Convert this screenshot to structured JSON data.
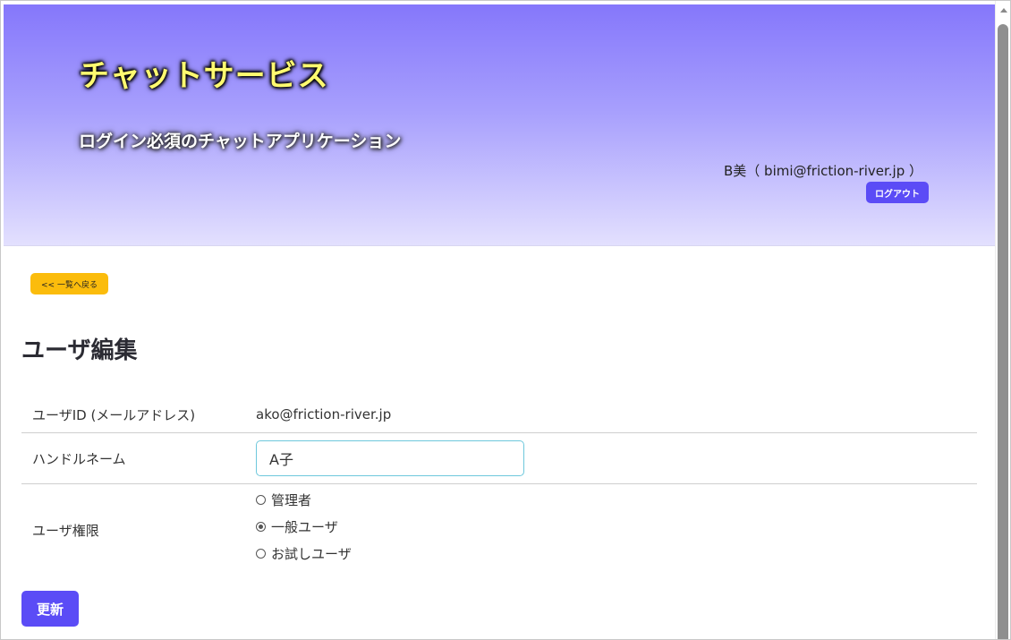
{
  "header": {
    "site_title": "チャットサービス",
    "site_subtitle": "ログイン必須のチャットアプリケーション",
    "user_info": "B美（ bimi@friction-river.jp ）",
    "logout_label": "ログアウト"
  },
  "nav": {
    "back_label": "<< 一覧へ戻る"
  },
  "page": {
    "title": "ユーザ編集"
  },
  "form": {
    "user_id_label": "ユーザID (メールアドレス)",
    "user_id_value": "ako@friction-river.jp",
    "handle_label": "ハンドルネーム",
    "handle_value": "A子",
    "role_label": "ユーザ権限",
    "roles": [
      {
        "label": "管理者",
        "checked": false
      },
      {
        "label": "一般ユーザ",
        "checked": true
      },
      {
        "label": "お試しユーザ",
        "checked": false
      }
    ],
    "submit_label": "更新"
  },
  "colors": {
    "primary_button": "#5b4cf6",
    "back_button": "#fbbc0c",
    "title_text": "#fffa70",
    "header_gradient_top": "#8577fb",
    "header_gradient_bottom": "#e3e0fe",
    "input_border": "#6ec8dc"
  }
}
